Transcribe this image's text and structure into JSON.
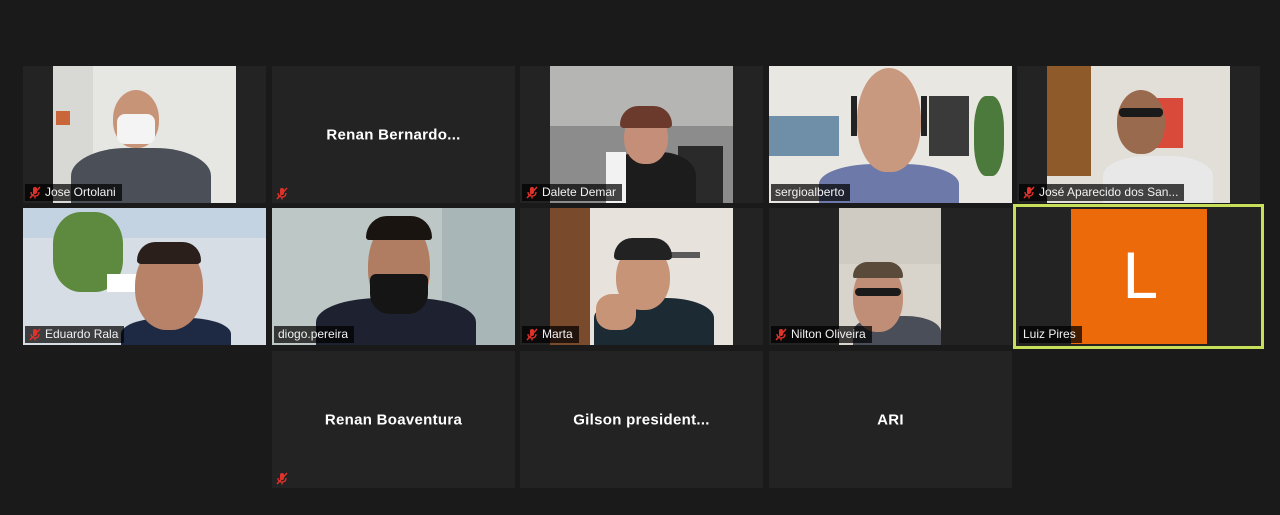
{
  "participants": [
    {
      "name": "Jose Ortolani",
      "muted": true
    },
    {
      "name": "Renan  Bernardo...",
      "muted": true
    },
    {
      "name": "Dalete Demar",
      "muted": true
    },
    {
      "name": "sergioalberto",
      "muted": false
    },
    {
      "name": "José Aparecido dos San...",
      "muted": true
    },
    {
      "name": "Eduardo Rala",
      "muted": true
    },
    {
      "name": "diogo.pereira",
      "muted": false
    },
    {
      "name": "Marta",
      "muted": true
    },
    {
      "name": "Nilton Oliveira",
      "muted": true
    },
    {
      "name": "Luiz Pires",
      "muted": false,
      "avatar_letter": "L",
      "avatar_color": "#ec6a0a",
      "active_speaker": true
    },
    {
      "name": "Renan Boaventura",
      "muted": true
    },
    {
      "name": "Gilson  president...",
      "muted": false
    },
    {
      "name": "ARI",
      "muted": false
    }
  ],
  "colors": {
    "background": "#1a1a1a",
    "tile": "#232323",
    "active_border": "#c6e05a",
    "mute_icon": "#e0322a"
  }
}
